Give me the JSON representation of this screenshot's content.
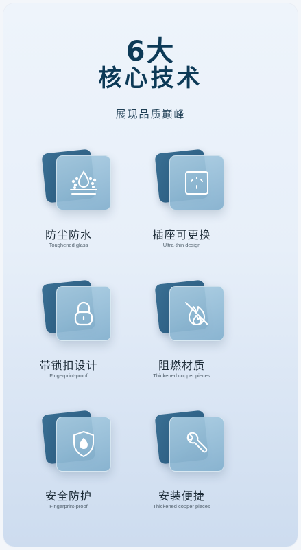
{
  "header": {
    "title_line1": "6大",
    "title_line2": "核心技术",
    "subtitle": "展现品质巅峰"
  },
  "features": [
    {
      "title": "防尘防水",
      "subtitle": "Toughened glass",
      "icon": "water-drop-icon"
    },
    {
      "title": "插座可更换",
      "subtitle": "Ultra-thin design",
      "icon": "socket-icon"
    },
    {
      "title": "带锁扣设计",
      "subtitle": "Fingerprint-proof",
      "icon": "lock-icon"
    },
    {
      "title": "阻燃材质",
      "subtitle": "Thickened copper pieces",
      "icon": "no-fire-icon"
    },
    {
      "title": "安全防护",
      "subtitle": "Fingerprint-proof",
      "icon": "shield-drop-icon"
    },
    {
      "title": "安装便捷",
      "subtitle": "Thickened copper pieces",
      "icon": "wrench-icon"
    }
  ],
  "colors": {
    "title": "#0d3a57",
    "tile_dark": "#2a5b80",
    "tile_light": "#9cc2da"
  }
}
